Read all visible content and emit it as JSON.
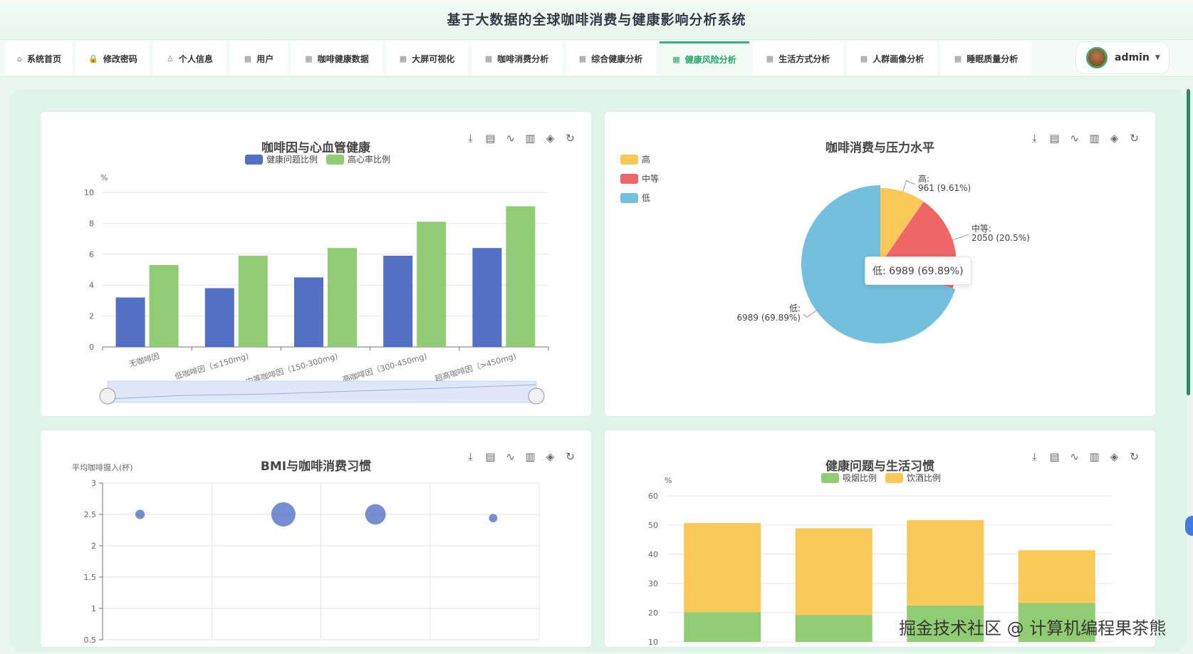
{
  "app": {
    "title": "基于大数据的全球咖啡消费与健康影响分析系统"
  },
  "nav": [
    {
      "label": "系统首页",
      "icon": "home-icon",
      "glyph": "⌂"
    },
    {
      "label": "修改密码",
      "icon": "lock-icon",
      "glyph": "🔒"
    },
    {
      "label": "个人信息",
      "icon": "user-icon",
      "glyph": "♙"
    },
    {
      "label": "用户",
      "icon": "grid-icon",
      "glyph": "▦"
    },
    {
      "label": "咖啡健康数据",
      "icon": "grid-icon",
      "glyph": "▦"
    },
    {
      "label": "大屏可视化",
      "icon": "grid-icon",
      "glyph": "▦"
    },
    {
      "label": "咖啡消费分析",
      "icon": "grid-icon",
      "glyph": "▦"
    },
    {
      "label": "综合健康分析",
      "icon": "grid-icon",
      "glyph": "▦"
    },
    {
      "label": "健康风险分析",
      "icon": "grid-icon",
      "glyph": "▦",
      "active": true
    },
    {
      "label": "生活方式分析",
      "icon": "grid-icon",
      "glyph": "▦"
    },
    {
      "label": "人群画像分析",
      "icon": "grid-icon",
      "glyph": "▦"
    },
    {
      "label": "睡眠质量分析",
      "icon": "grid-icon",
      "glyph": "▦"
    }
  ],
  "user": {
    "name": "admin"
  },
  "toolbox": [
    {
      "name": "download-icon",
      "glyph": "⤓"
    },
    {
      "name": "data-view-icon",
      "glyph": "▤"
    },
    {
      "name": "line-switch-icon",
      "glyph": "∿"
    },
    {
      "name": "bar-switch-icon",
      "glyph": "▥"
    },
    {
      "name": "stack-icon",
      "glyph": "◈"
    },
    {
      "name": "restore-icon",
      "glyph": "↻"
    }
  ],
  "colors": {
    "blue": "#5470c6",
    "green": "#91cc75",
    "yellow": "#fac858",
    "red": "#ee6666",
    "lightblue": "#73c0de",
    "accent": "#20a765"
  },
  "chart_data": [
    {
      "id": "caffeine-cardio",
      "type": "bar",
      "title": "咖啡因与心血管健康",
      "ylabel": "%",
      "ylim": [
        0,
        10
      ],
      "yticks": [
        "0",
        "2",
        "4",
        "6",
        "8",
        "10"
      ],
      "categories": [
        "无咖啡因",
        "低咖啡因（≤150mg)",
        "中等咖啡因（150-300mg)",
        "高咖啡因（300-450mg)",
        "超高咖啡因（>450mg)"
      ],
      "series": [
        {
          "name": "健康问题比例",
          "values": [
            3.2,
            3.8,
            4.5,
            5.9,
            6.4
          ]
        },
        {
          "name": "高心率比例",
          "values": [
            5.3,
            5.9,
            6.4,
            8.1,
            9.1
          ]
        }
      ],
      "grid": true,
      "legend": "top-center"
    },
    {
      "id": "coffee-stress",
      "type": "pie",
      "title": "咖啡消费与压力水平",
      "slices": [
        {
          "name": "高",
          "value": 961,
          "label": "961 (9.61%)"
        },
        {
          "name": "中等",
          "value": 2050,
          "label": "2050 (20.5%)"
        },
        {
          "name": "低",
          "value": 6989,
          "label": "6989 (69.89%)"
        }
      ],
      "tooltip": "低: 6989 (69.89%)",
      "legend": "top-left"
    },
    {
      "id": "bmi-coffee",
      "type": "scatter",
      "title": "BMI与咖啡消费习惯",
      "ylabel": "平均咖啡摄入(杯)",
      "ylim": [
        0.5,
        3
      ],
      "yticks": [
        "0.5",
        "1",
        "1.5",
        "2",
        "2.5",
        "3"
      ],
      "points": [
        {
          "x": 1,
          "y": 2.5,
          "size": 2
        },
        {
          "x": 2,
          "y": 2.5,
          "size": 10
        },
        {
          "x": 3,
          "y": 2.5,
          "size": 8
        },
        {
          "x": 4,
          "y": 2.44,
          "size": 1.5
        }
      ],
      "grid": true
    },
    {
      "id": "health-lifestyle",
      "type": "bar",
      "stacked": true,
      "title": "健康问题与生活习惯",
      "ylabel": "%",
      "ylim": [
        10,
        60
      ],
      "yticks": [
        "10",
        "20",
        "30",
        "40",
        "50",
        "60"
      ],
      "categories": [
        "",
        "",
        "",
        ""
      ],
      "series": [
        {
          "name": "吸烟比例",
          "values": [
            20.2,
            19.2,
            22.5,
            23.3
          ]
        },
        {
          "name": "饮酒比例",
          "values": [
            30.5,
            29.7,
            29.2,
            18.1
          ]
        }
      ],
      "grid": true,
      "legend": "top-center"
    }
  ],
  "watermark": "掘金技术社区 @ 计算机编程果茶熊"
}
